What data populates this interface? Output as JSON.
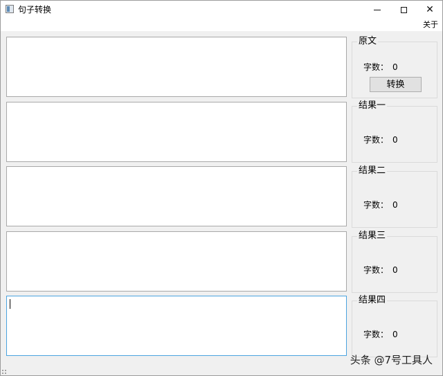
{
  "window": {
    "title": "句子转换",
    "controls": {
      "minimize": "—",
      "maximize": "☐",
      "close": "✕"
    }
  },
  "menu": {
    "about": "关于"
  },
  "panels": [
    {
      "title": "原文",
      "count_label": "字数：",
      "count": "0",
      "button": "转换"
    },
    {
      "title": "结果一",
      "count_label": "字数：",
      "count": "0"
    },
    {
      "title": "结果二",
      "count_label": "字数：",
      "count": "0"
    },
    {
      "title": "结果三",
      "count_label": "字数：",
      "count": "0"
    },
    {
      "title": "结果四",
      "count_label": "字数：",
      "count": "0"
    }
  ],
  "watermark": "头条 @7号工具人"
}
